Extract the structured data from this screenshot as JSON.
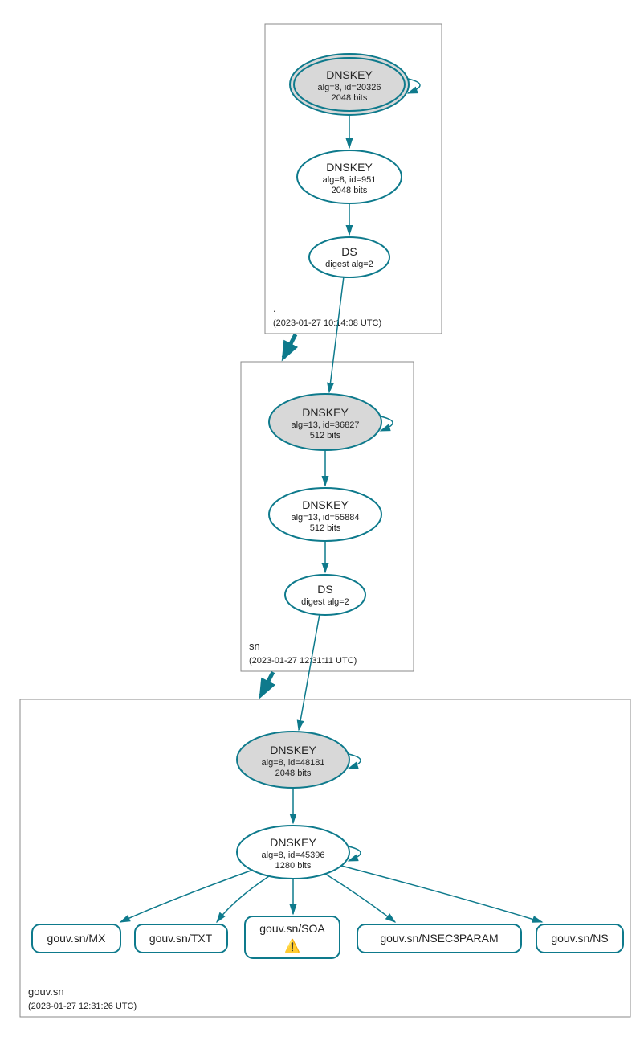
{
  "zones": {
    "root": {
      "label": ".",
      "timestamp": "(2023-01-27 10:14:08 UTC)",
      "ksk": {
        "title": "DNSKEY",
        "alg": "alg=8, id=20326",
        "bits": "2048 bits"
      },
      "zsk": {
        "title": "DNSKEY",
        "alg": "alg=8, id=951",
        "bits": "2048 bits"
      },
      "ds": {
        "title": "DS",
        "digest": "digest alg=2"
      }
    },
    "sn": {
      "label": "sn",
      "timestamp": "(2023-01-27 12:31:11 UTC)",
      "ksk": {
        "title": "DNSKEY",
        "alg": "alg=13, id=36827",
        "bits": "512 bits"
      },
      "zsk": {
        "title": "DNSKEY",
        "alg": "alg=13, id=55884",
        "bits": "512 bits"
      },
      "ds": {
        "title": "DS",
        "digest": "digest alg=2"
      }
    },
    "gouvsn": {
      "label": "gouv.sn",
      "timestamp": "(2023-01-27 12:31:26 UTC)",
      "ksk": {
        "title": "DNSKEY",
        "alg": "alg=8, id=48181",
        "bits": "2048 bits"
      },
      "zsk": {
        "title": "DNSKEY",
        "alg": "alg=8, id=45396",
        "bits": "1280 bits"
      },
      "records": {
        "mx": "gouv.sn/MX",
        "txt": "gouv.sn/TXT",
        "soa": "gouv.sn/SOA",
        "nsec3param": "gouv.sn/NSEC3PARAM",
        "ns": "gouv.sn/NS"
      },
      "soa_warning": "⚠️"
    }
  }
}
